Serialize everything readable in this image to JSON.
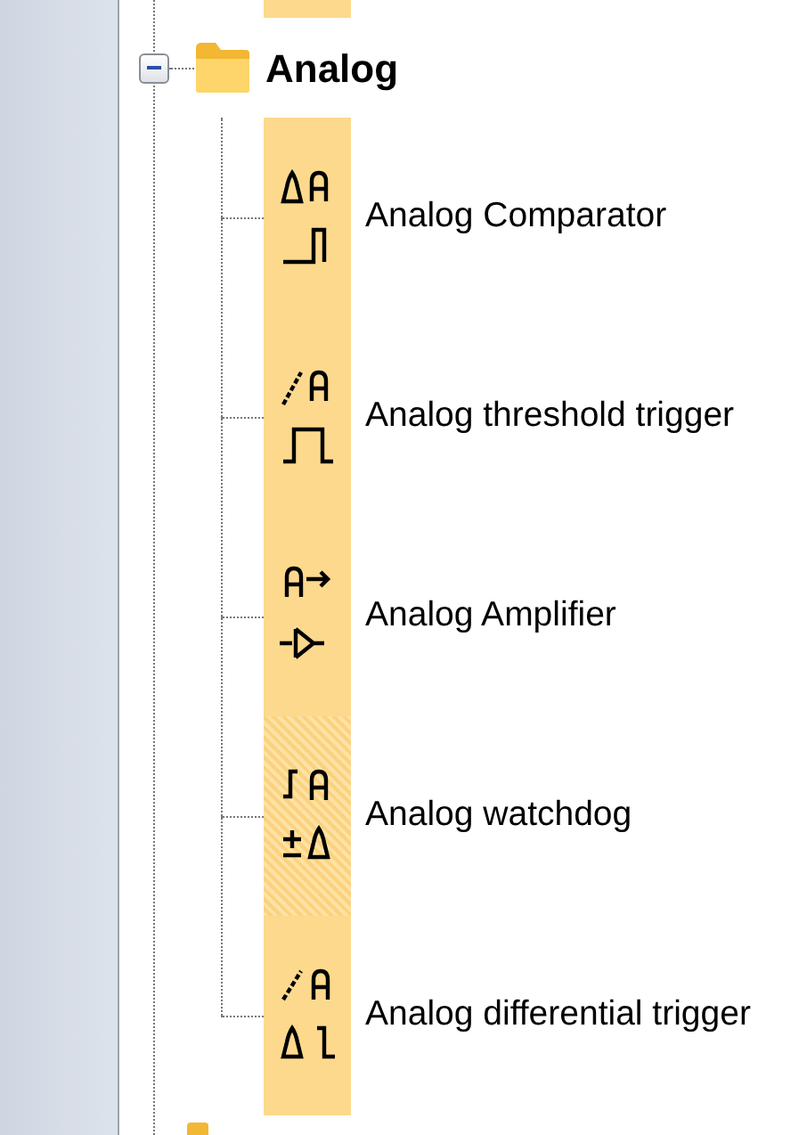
{
  "folder": {
    "label": "Analog",
    "expanded": true
  },
  "items": [
    {
      "label": "Analog Comparator",
      "kind": "comparator",
      "selected": false
    },
    {
      "label": "Analog threshold trigger",
      "kind": "threshold",
      "selected": false
    },
    {
      "label": "Analog Amplifier",
      "kind": "amplifier",
      "selected": false
    },
    {
      "label": "Analog watchdog",
      "kind": "watchdog",
      "selected": true
    },
    {
      "label": "Analog differential trigger",
      "kind": "differential",
      "selected": false
    }
  ]
}
